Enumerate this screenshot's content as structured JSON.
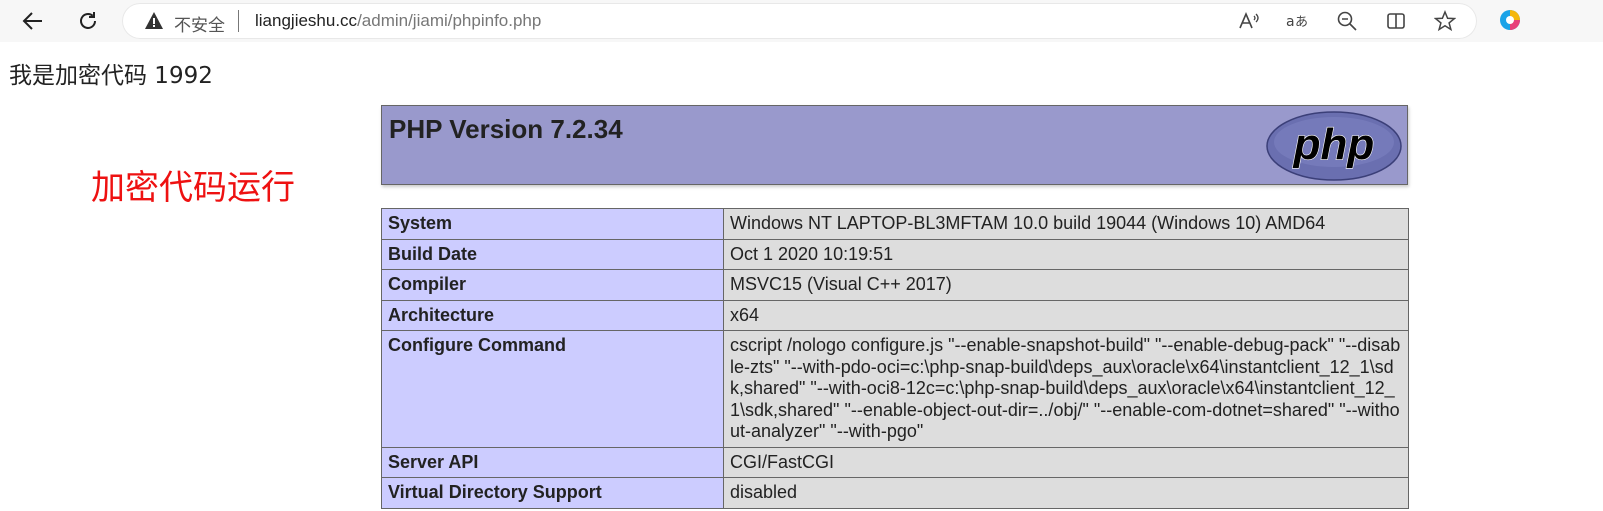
{
  "browser": {
    "address": {
      "security_label": "不安全",
      "url_host": "liangjieshu.cc",
      "url_path": "/admin/jiami/phpinfo.php"
    },
    "icons": [
      "back-icon",
      "refresh-icon",
      "warning-icon",
      "read-aloud-icon",
      "translate-icon",
      "zoom-out-icon",
      "split-screen-icon",
      "favorite-icon",
      "edge-icon"
    ]
  },
  "page": {
    "top_text": "我是加密代码 1992",
    "red_text": "加密代码运行",
    "php_version": "PHP Version 7.2.34",
    "logo_text": "php",
    "info_rows": [
      {
        "key": "System",
        "value": "Windows NT LAPTOP-BL3MFTAM 10.0 build 19044 (Windows 10) AMD64"
      },
      {
        "key": "Build Date",
        "value": "Oct 1 2020 10:19:51"
      },
      {
        "key": "Compiler",
        "value": "MSVC15 (Visual C++ 2017)"
      },
      {
        "key": "Architecture",
        "value": "x64"
      },
      {
        "key": "Configure Command",
        "value": "cscript /nologo configure.js \"--enable-snapshot-build\" \"--enable-debug-pack\" \"--disable-zts\" \"--with-pdo-oci=c:\\php-snap-build\\deps_aux\\oracle\\x64\\instantclient_12_1\\sdk,shared\" \"--with-oci8-12c=c:\\php-snap-build\\deps_aux\\oracle\\x64\\instantclient_12_1\\sdk,shared\" \"--enable-object-out-dir=../obj/\" \"--enable-com-dotnet=shared\" \"--without-analyzer\" \"--with-pgo\""
      },
      {
        "key": "Server API",
        "value": "CGI/FastCGI"
      },
      {
        "key": "Virtual Directory Support",
        "value": "disabled"
      }
    ]
  },
  "colors": {
    "header_bg": "#9999cc",
    "key_bg": "#ccccff",
    "value_bg": "#dddddd",
    "red_text": "#ee1111"
  }
}
